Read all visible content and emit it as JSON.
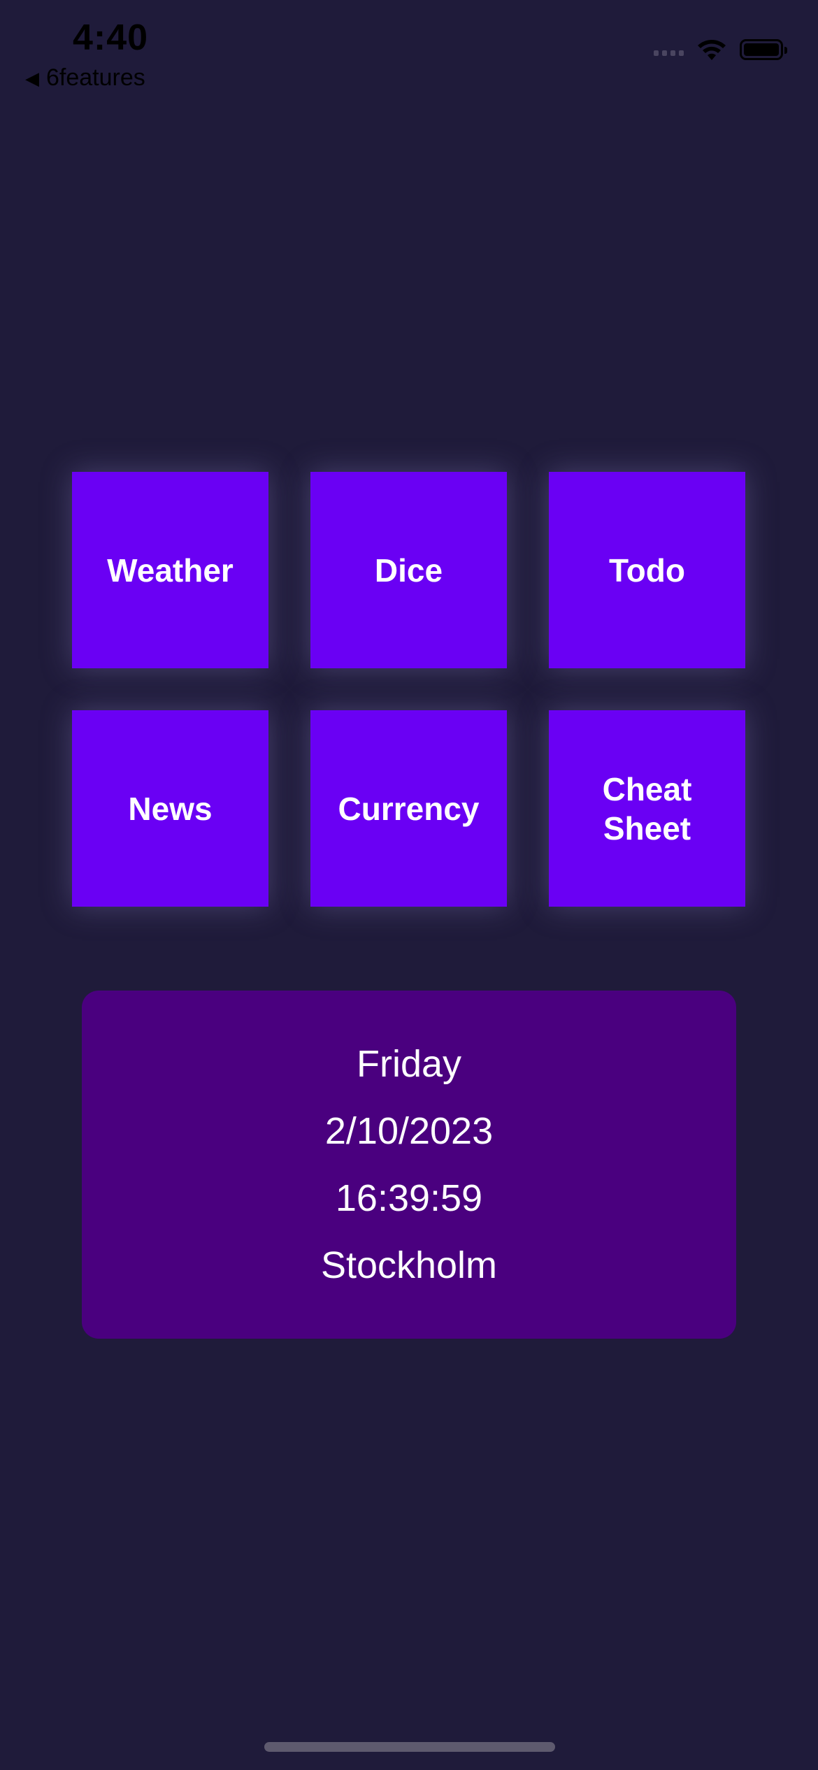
{
  "status_bar": {
    "time": "4:40",
    "back_label": "6features",
    "wifi_icon": "wifi-icon",
    "battery_icon": "battery-icon"
  },
  "features": [
    {
      "label": "Weather"
    },
    {
      "label": "Dice"
    },
    {
      "label": "Todo"
    },
    {
      "label": "News"
    },
    {
      "label": "Currency"
    },
    {
      "label": "Cheat Sheet"
    }
  ],
  "info": {
    "day": "Friday",
    "date": "2/10/2023",
    "time": "16:39:59",
    "city": "Stockholm"
  },
  "colors": {
    "background": "#1f1b3a",
    "tile": "#6a00f4",
    "card": "#4a007f",
    "text": "#ffffff"
  }
}
